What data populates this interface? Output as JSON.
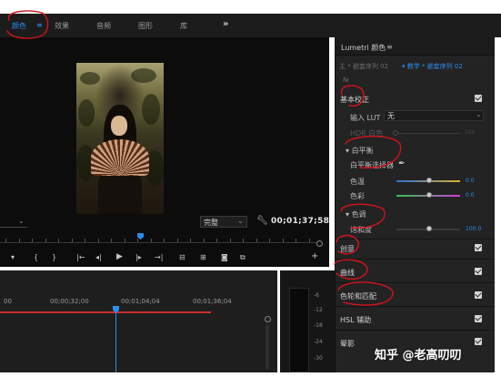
{
  "workspace_tabs": [
    {
      "label": "颜色",
      "active": true
    },
    {
      "label": "效果",
      "active": false
    },
    {
      "label": "音频",
      "active": false
    },
    {
      "label": "图形",
      "active": false
    },
    {
      "label": "库",
      "active": false
    }
  ],
  "workspace_menu_glyph": "≡",
  "workspace_more_glyph": "»",
  "monitor": {
    "zoom_value": "",
    "quality": "完整",
    "timecode": "00;01;37;58"
  },
  "transport": [
    "▾",
    "{",
    "}",
    "|←",
    "◂|",
    "▶",
    "|▸",
    "→|",
    "⊟",
    "⊞",
    "◙",
    "⧉",
    "+"
  ],
  "timeline": {
    "ruler": [
      "00",
      "00;00;32;00",
      "00;01;04;04",
      "00;01;36;04"
    ]
  },
  "meters": {
    "labels": [
      "-6",
      "-12",
      "-18",
      "-24",
      "-30"
    ]
  },
  "lumetri": {
    "title": "Lumetri 颜色",
    "menu_glyph": "≡",
    "sequence_left": "主 * 嵌套序列 02",
    "sequence_right": "▾ 教学 * 嵌套序列 02",
    "fx_glyph": "fx",
    "basic_correction": {
      "title": "基本校正",
      "enabled": true,
      "input_lut_label": "输入 LUT",
      "input_lut_value": "无",
      "hdr_white_label": "HDR 白色",
      "hdr_white_value": "100",
      "white_balance_label": "白平衡",
      "wb_selector_label": "白平衡选择器",
      "temperature_label": "色温",
      "temperature_value": "0.0",
      "tint_label": "色彩",
      "tint_value": "0.0",
      "tone_label": "色调",
      "saturation_label": "饱和度",
      "saturation_value": "100.0"
    },
    "sections": [
      {
        "title": "创意",
        "enabled": true
      },
      {
        "title": "曲线",
        "enabled": true
      },
      {
        "title": "色轮和匹配",
        "enabled": true
      },
      {
        "title": "HSL 辅助",
        "enabled": true
      },
      {
        "title": "晕影",
        "enabled": true
      }
    ]
  },
  "watermark": "知乎 @老高叨叨",
  "colors": {
    "accent": "#2d8ceb",
    "annotation": "#d0141c",
    "work_area": "#c9302c"
  }
}
